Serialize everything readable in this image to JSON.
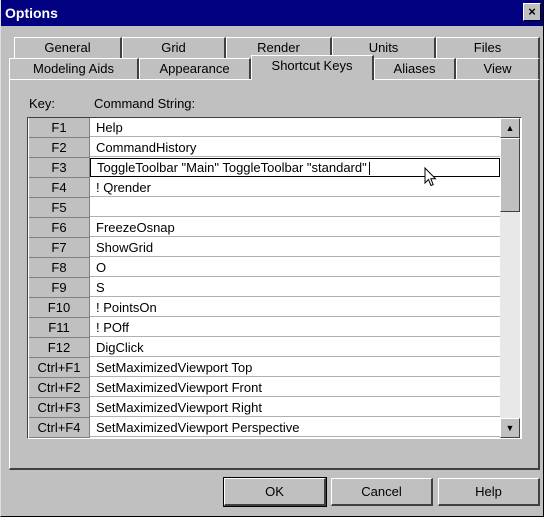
{
  "window": {
    "title": "Options",
    "close_glyph": "×"
  },
  "tabs": {
    "back_row": [
      "General",
      "Grid",
      "Render",
      "Units",
      "Files"
    ],
    "front_row": [
      "Modeling Aids",
      "Appearance",
      "Shortcut Keys",
      "Aliases",
      "View"
    ],
    "selected": "Shortcut Keys"
  },
  "headers": {
    "key": "Key:",
    "command": "Command String:"
  },
  "rows": [
    {
      "key": "F1",
      "command": "Help"
    },
    {
      "key": "F2",
      "command": "CommandHistory"
    },
    {
      "key": "F3",
      "command": "ToggleToolbar \"Main\" ToggleToolbar \"standard\""
    },
    {
      "key": "F4",
      "command": "! Qrender"
    },
    {
      "key": "F5",
      "command": ""
    },
    {
      "key": "F6",
      "command": "FreezeOsnap"
    },
    {
      "key": "F7",
      "command": "ShowGrid"
    },
    {
      "key": "F8",
      "command": "O"
    },
    {
      "key": "F9",
      "command": "S"
    },
    {
      "key": "F10",
      "command": "! PointsOn"
    },
    {
      "key": "F11",
      "command": "! POff"
    },
    {
      "key": "F12",
      "command": "DigClick"
    },
    {
      "key": "Ctrl+F1",
      "command": "SetMaximizedViewport Top"
    },
    {
      "key": "Ctrl+F2",
      "command": "SetMaximizedViewport Front"
    },
    {
      "key": "Ctrl+F3",
      "command": "SetMaximizedViewport Right"
    },
    {
      "key": "Ctrl+F4",
      "command": "SetMaximizedViewport Perspective"
    }
  ],
  "editing_row": 2,
  "scrollbar": {
    "up_icon": "▲",
    "down_icon": "▼"
  },
  "buttons": {
    "ok": "OK",
    "cancel": "Cancel",
    "help": "Help"
  },
  "colors": {
    "titlebar": "#000080",
    "face": "#c0c0c0"
  }
}
